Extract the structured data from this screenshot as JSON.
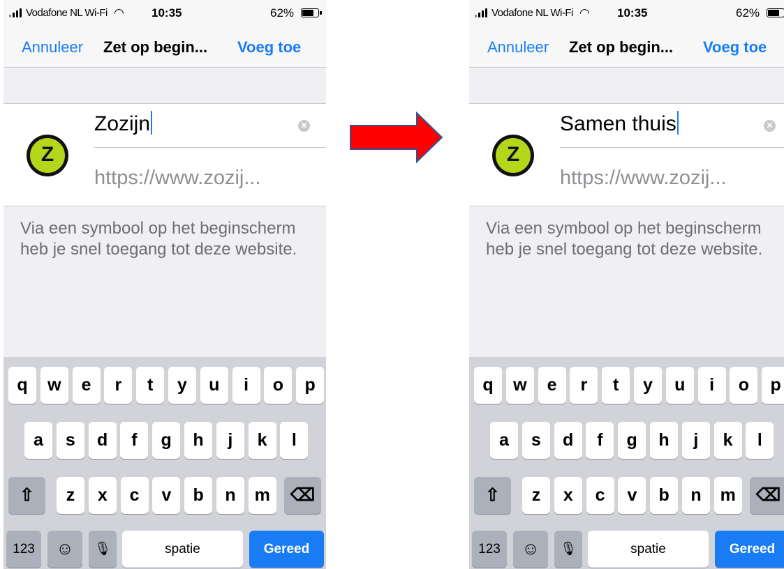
{
  "status": {
    "carrier": "Vodafone NL Wi-Fi",
    "time": "10:35",
    "battery_pct": "62%"
  },
  "nav": {
    "cancel": "Annuleer",
    "title": "Zet op begin...",
    "add": "Voeg toe"
  },
  "site_icon_letter": "Z",
  "screens": [
    {
      "name_value": "Zozijn"
    },
    {
      "name_value": "Samen thuis"
    }
  ],
  "url": "https://www.zozij...",
  "description": "Via een symbool op het beginscherm heb je snel toegang tot deze website.",
  "keyboard": {
    "row1": [
      "q",
      "w",
      "e",
      "r",
      "t",
      "y",
      "u",
      "i",
      "o",
      "p"
    ],
    "row2": [
      "a",
      "s",
      "d",
      "f",
      "g",
      "h",
      "j",
      "k",
      "l"
    ],
    "row3": [
      "z",
      "x",
      "c",
      "v",
      "b",
      "n",
      "m"
    ],
    "numbers": "123",
    "space": "spatie",
    "done": "Gereed"
  },
  "colors": {
    "accent": "#1a7cf5",
    "arrow": "#ff0000",
    "icon_green": "#b5d71b"
  }
}
